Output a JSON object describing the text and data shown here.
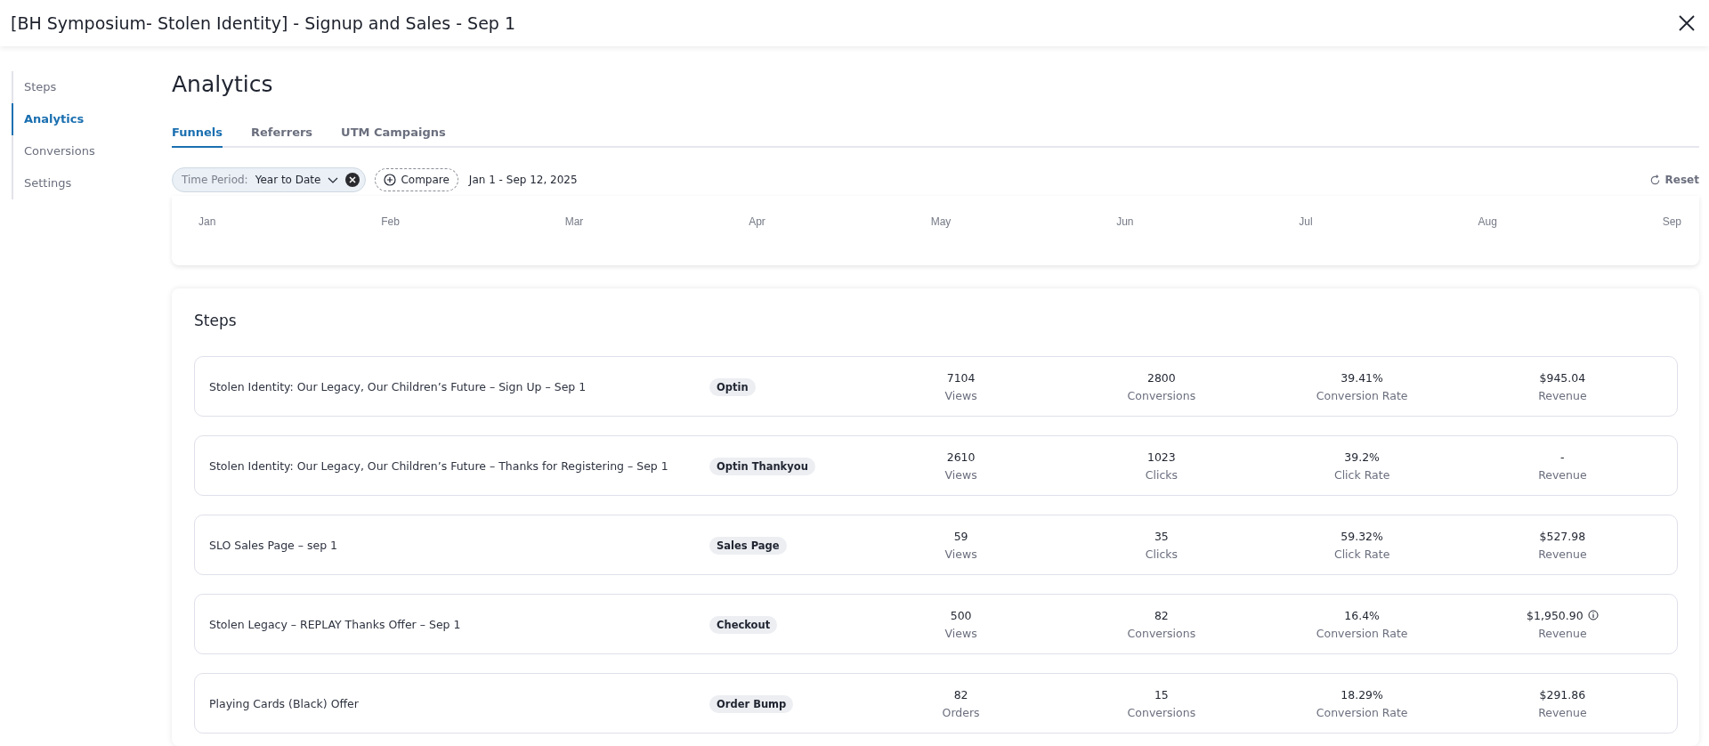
{
  "window": {
    "title": "[BH Symposium- Stolen Identity] - Signup and Sales - Sep 1"
  },
  "sidebar": {
    "items": [
      {
        "label": "Steps",
        "selected": false
      },
      {
        "label": "Analytics",
        "selected": true
      },
      {
        "label": "Conversions",
        "selected": false
      },
      {
        "label": "Settings",
        "selected": false
      }
    ]
  },
  "heading": "Analytics",
  "tabs": [
    {
      "label": "Funnels",
      "selected": true
    },
    {
      "label": "Referrers",
      "selected": false
    },
    {
      "label": "UTM Campaigns",
      "selected": false
    }
  ],
  "filters": {
    "time_period": {
      "label": "Time Period:",
      "value": "Year to Date"
    },
    "compare": "Compare",
    "date_range": "Jan 1 - Sep 12, 2025",
    "reset": "Reset"
  },
  "chart_axis": {
    "months": [
      "Jan",
      "Feb",
      "Mar",
      "Apr",
      "May",
      "Jun",
      "Jul",
      "Aug",
      "Sep"
    ]
  },
  "steps": {
    "title": "Steps",
    "rows": [
      {
        "name": "Stolen Identity: Our Legacy, Our Children’s Future – Sign Up – Sep 1",
        "type": "Optin",
        "metrics": [
          {
            "value": "7104",
            "label": "Views"
          },
          {
            "value": "2800",
            "label": "Conversions"
          },
          {
            "value": "39.41%",
            "label": "Conversion Rate"
          },
          {
            "value": "$945.04",
            "label": "Revenue",
            "info": false
          }
        ]
      },
      {
        "name": "Stolen Identity: Our Legacy, Our Children’s Future – Thanks for Registering – Sep 1",
        "type": "Optin Thankyou",
        "metrics": [
          {
            "value": "2610",
            "label": "Views"
          },
          {
            "value": "1023",
            "label": "Clicks"
          },
          {
            "value": "39.2%",
            "label": "Click Rate"
          },
          {
            "value": "-",
            "label": "Revenue",
            "info": false
          }
        ]
      },
      {
        "name": "SLO Sales Page – sep 1",
        "type": "Sales Page",
        "metrics": [
          {
            "value": "59",
            "label": "Views"
          },
          {
            "value": "35",
            "label": "Clicks"
          },
          {
            "value": "59.32%",
            "label": "Click Rate"
          },
          {
            "value": "$527.98",
            "label": "Revenue",
            "info": false
          }
        ]
      },
      {
        "name": "Stolen Legacy – REPLAY Thanks Offer – Sep 1",
        "type": "Checkout",
        "metrics": [
          {
            "value": "500",
            "label": "Views"
          },
          {
            "value": "82",
            "label": "Conversions"
          },
          {
            "value": "16.4%",
            "label": "Conversion Rate"
          },
          {
            "value": "$1,950.90",
            "label": "Revenue",
            "info": true
          }
        ]
      },
      {
        "name": "Playing Cards (Black) Offer",
        "type": "Order Bump",
        "metrics": [
          {
            "value": "82",
            "label": "Orders"
          },
          {
            "value": "15",
            "label": "Conversions"
          },
          {
            "value": "18.29%",
            "label": "Conversion Rate"
          },
          {
            "value": "$291.86",
            "label": "Revenue",
            "info": false
          }
        ]
      }
    ]
  }
}
